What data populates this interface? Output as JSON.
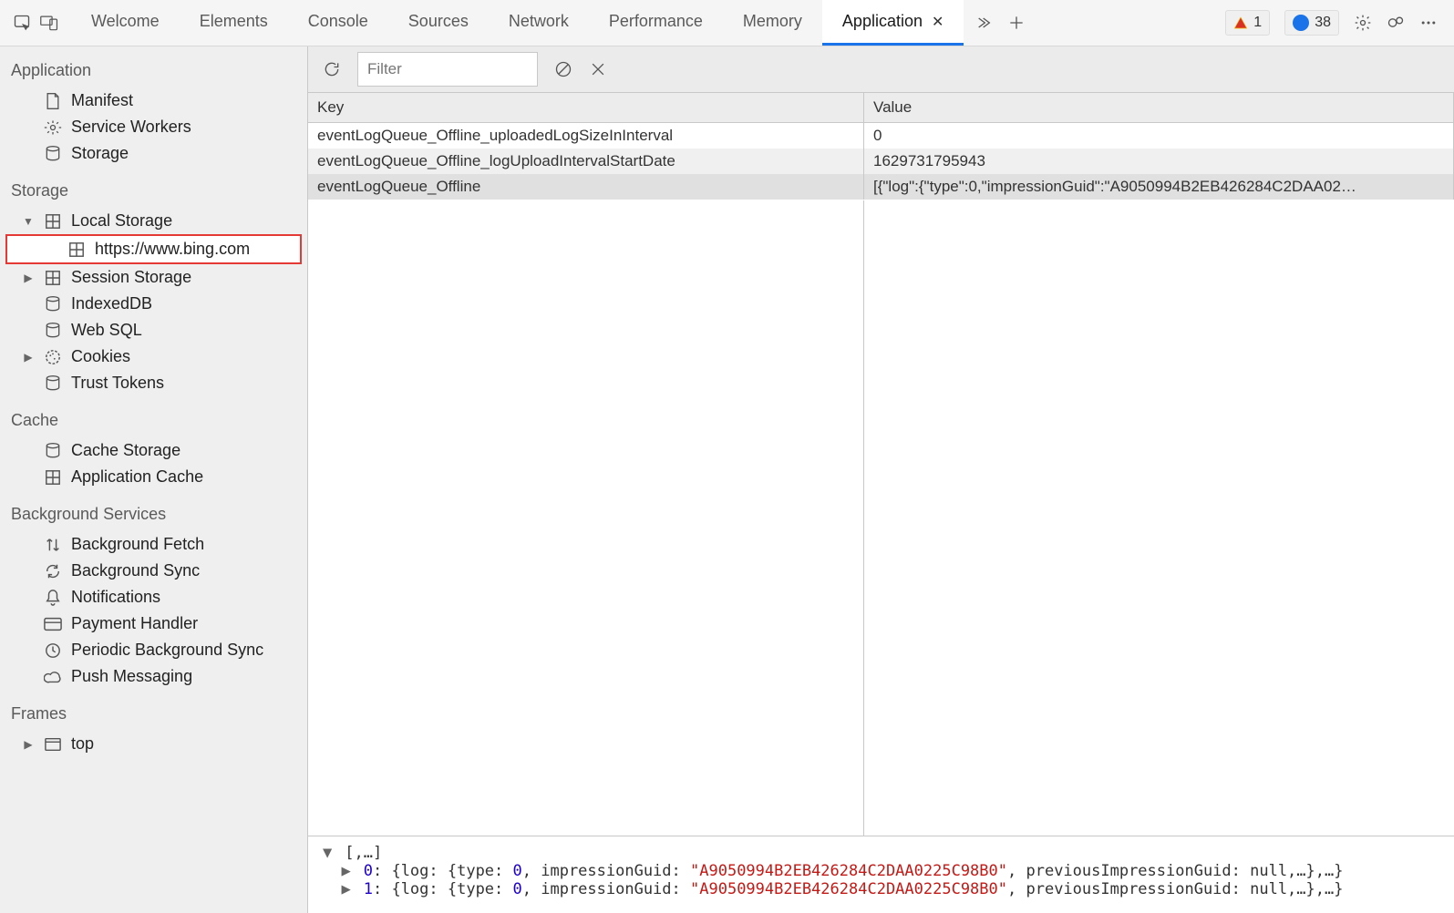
{
  "tabstrip": {
    "tabs": [
      {
        "label": "Welcome"
      },
      {
        "label": "Elements"
      },
      {
        "label": "Console"
      },
      {
        "label": "Sources"
      },
      {
        "label": "Network"
      },
      {
        "label": "Performance"
      },
      {
        "label": "Memory"
      },
      {
        "label": "Application",
        "active": true
      }
    ],
    "warn_count": "1",
    "info_count": "38"
  },
  "toolbar": {
    "filter_placeholder": "Filter"
  },
  "sidebar": {
    "sections": {
      "application": {
        "title": "Application",
        "items": [
          {
            "label": "Manifest"
          },
          {
            "label": "Service Workers"
          },
          {
            "label": "Storage"
          }
        ]
      },
      "storage": {
        "title": "Storage",
        "items": {
          "local_storage": {
            "label": "Local Storage",
            "expanded": true,
            "children": [
              {
                "label": "https://www.bing.com",
                "highlight": true
              }
            ]
          },
          "session_storage": {
            "label": "Session Storage"
          },
          "indexeddb": {
            "label": "IndexedDB"
          },
          "websql": {
            "label": "Web SQL"
          },
          "cookies": {
            "label": "Cookies"
          },
          "trust_tokens": {
            "label": "Trust Tokens"
          }
        }
      },
      "cache": {
        "title": "Cache",
        "items": [
          {
            "label": "Cache Storage"
          },
          {
            "label": "Application Cache"
          }
        ]
      },
      "background": {
        "title": "Background Services",
        "items": [
          {
            "label": "Background Fetch"
          },
          {
            "label": "Background Sync"
          },
          {
            "label": "Notifications"
          },
          {
            "label": "Payment Handler"
          },
          {
            "label": "Periodic Background Sync"
          },
          {
            "label": "Push Messaging"
          }
        ]
      },
      "frames": {
        "title": "Frames",
        "items": [
          {
            "label": "top"
          }
        ]
      }
    }
  },
  "table": {
    "headers": {
      "key": "Key",
      "value": "Value"
    },
    "rows": [
      {
        "key": "eventLogQueue_Offline_uploadedLogSizeInInterval",
        "value": "0"
      },
      {
        "key": "eventLogQueue_Offline_logUploadIntervalStartDate",
        "value": "1629731795943"
      },
      {
        "key": "eventLogQueue_Offline",
        "value": "[{\"log\":{\"type\":0,\"impressionGuid\":\"A9050994B2EB426284C2DAA02…"
      }
    ]
  },
  "preview": {
    "root": "[,…]",
    "lines": [
      {
        "idx": "0",
        "guid": "A9050994B2EB426284C2DAA0225C98B0"
      },
      {
        "idx": "1",
        "guid": "A9050994B2EB426284C2DAA0225C98B0"
      }
    ]
  }
}
